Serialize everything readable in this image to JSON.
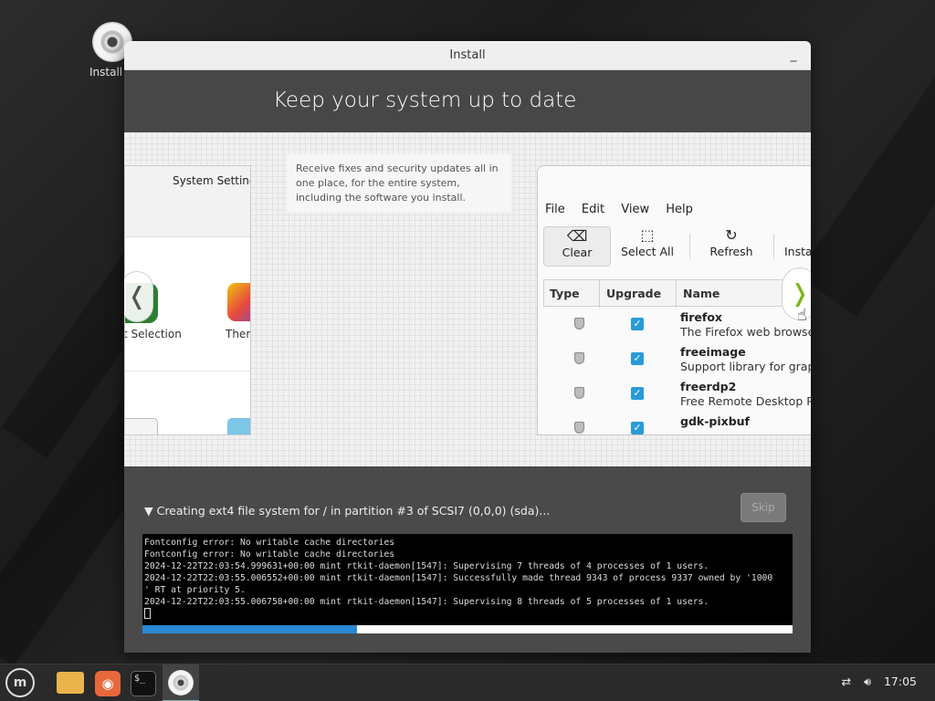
{
  "desktop": {
    "icon_label": "Install"
  },
  "window": {
    "title": "Install",
    "minimize_glyph": "_"
  },
  "header": {
    "title": "Keep your system up to date"
  },
  "slide": {
    "description": "Receive fixes and security updates all in one place, for the entire system, including the software you install.",
    "left_panel": {
      "title": "System Settings",
      "label1": "t Selection",
      "label2": "Them"
    },
    "nav_prev_glyph": "❬",
    "nav_next_glyph": "❭",
    "update_manager": {
      "menu": [
        "File",
        "Edit",
        "View",
        "Help"
      ],
      "toolbar": {
        "clear": "Clear",
        "select_all": "Select All",
        "refresh": "Refresh",
        "install": "Insta"
      },
      "columns": {
        "type": "Type",
        "upgrade": "Upgrade",
        "name": "Name"
      },
      "rows": [
        {
          "name": "firefox",
          "desc": "The Firefox web browse"
        },
        {
          "name": "freeimage",
          "desc": "Support library for grap"
        },
        {
          "name": "freerdp2",
          "desc": "Free Remote Desktop Pr"
        },
        {
          "name": "gdk-pixbuf",
          "desc": ""
        }
      ]
    }
  },
  "installer": {
    "status": "▼ Creating ext4 file system for / in partition #3 of SCSI7 (0,0,0) (sda)...",
    "skip_label": "Skip",
    "log": [
      "Fontconfig error: No writable cache directories",
      "Fontconfig error: No writable cache directories",
      "2024-12-22T22:03:54.999631+00:00 mint rtkit-daemon[1547]: Supervising 7 threads of 4 processes of 1 users.",
      "2024-12-22T22:03:55.006552+00:00 mint rtkit-daemon[1547]: Successfully made thread 9343 of process 9337 owned by '1000",
      "' RT at priority 5.",
      "2024-12-22T22:03:55.006758+00:00 mint rtkit-daemon[1547]: Supervising 8 threads of 5 processes of 1 users."
    ],
    "progress_percent": 33
  },
  "taskbar": {
    "terminal_glyph": "$_",
    "clock": "17:05"
  }
}
